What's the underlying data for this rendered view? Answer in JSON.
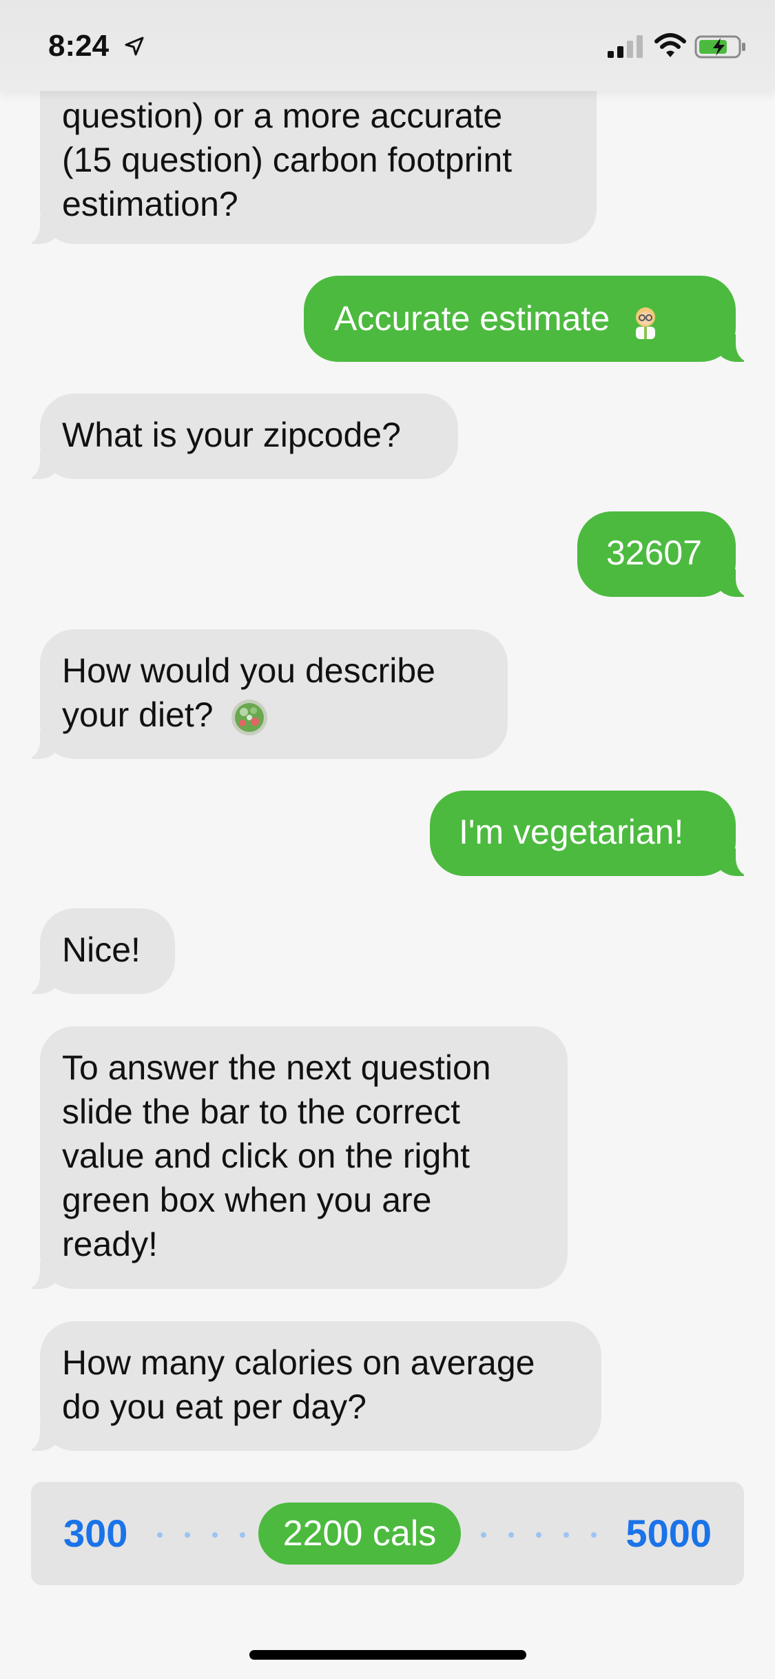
{
  "status_bar": {
    "time": "8:24",
    "battery_charging": true
  },
  "messages": [
    {
      "from": "bot",
      "lines": [
        "question) or a more accurate",
        "(15 question) carbon footprint",
        "estimation?"
      ]
    },
    {
      "from": "user",
      "text": "Accurate estimate",
      "emoji": "scientist-emoji"
    },
    {
      "from": "bot",
      "lines": [
        "What is your zipcode?"
      ]
    },
    {
      "from": "user",
      "text": "32607"
    },
    {
      "from": "bot",
      "lines": [
        "How would you describe",
        "your diet?"
      ],
      "emoji": "salad-emoji"
    },
    {
      "from": "user",
      "text": "I'm vegetarian!"
    },
    {
      "from": "bot",
      "lines": [
        "Nice!"
      ]
    },
    {
      "from": "bot",
      "lines": [
        "To answer the next question",
        "slide the bar to the correct",
        "value and click on the right",
        "green box when you are",
        "ready!"
      ]
    },
    {
      "from": "bot",
      "lines": [
        "How many calories on average",
        "do you eat per day?"
      ]
    }
  ],
  "slider": {
    "min_label": "300",
    "max_label": "5000",
    "value_label": "2200 cals",
    "min": 300,
    "max": 5000,
    "value": 2200
  },
  "colors": {
    "accent_green": "#4cba3f",
    "bot_bubble": "#e5e5e5",
    "link_blue": "#1a73e8",
    "background": "#f6f6f6"
  }
}
